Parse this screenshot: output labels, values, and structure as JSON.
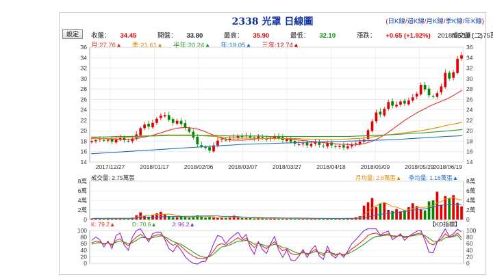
{
  "header": {
    "title": "2338 光罩 日線圖",
    "links": [
      "日K線",
      "週K線",
      "月K線",
      "季K線",
      "年K線"
    ],
    "active_link": 0
  },
  "settings_label": "設定",
  "quote": {
    "close_label": "收盤：",
    "close": "34.45",
    "open_label": "開盤：",
    "open": "33.80",
    "high_label": "最高：",
    "high": "35.90",
    "low_label": "最低：",
    "low": "32.10",
    "change_label": "漲跌：",
    "change": "+0.65 (+1.92%)",
    "volume": "成交量：2.75萬張",
    "date": "2018/06/19 (二)"
  },
  "ma": [
    {
      "label": "月:27.76▲",
      "color": "#e03020"
    },
    {
      "label": "季:21.61▲",
      "color": "#e08a00"
    },
    {
      "label": "半年:20.24▲",
      "color": "#2a9a2a"
    },
    {
      "label": "年:19.05▲",
      "color": "#2070c0"
    },
    {
      "label": "三年:12.74▲",
      "color": "#c00000"
    }
  ],
  "volume_panel": {
    "label": "成交量: 2.75萬張",
    "ma5": "月均量: 2.6萬張▲",
    "ma20": "季均量: 1.16萬張▲",
    "yticks": [
      "8萬",
      "6萬",
      "4萬",
      "2萬",
      "0"
    ]
  },
  "kd_panel": {
    "k": "K: 79.2▲",
    "d": "D: 70.6▲",
    "j": "J: 96.2▲",
    "title": "【KD指標】",
    "yticks": [
      "100",
      "80",
      "60",
      "40",
      "20",
      "0"
    ]
  },
  "colors": {
    "up": "#e00000",
    "down": "#008800",
    "k": "#e03020",
    "d": "#2a9a2a",
    "j": "#8a2ad0"
  },
  "chart_data": {
    "type": "line",
    "title": "2338 光罩 日線圖",
    "xlabel": "",
    "ylabel": "",
    "ylim": [
      14,
      36
    ],
    "yticks": [
      14,
      16,
      18,
      20,
      22,
      24,
      26,
      28,
      30,
      32,
      34,
      36
    ],
    "x_tick_labels": [
      "2017/12/27",
      "2018/01/17",
      "2018/02/06",
      "2018/03/07",
      "2018/03/27",
      "2018/04/18",
      "2018/05/09",
      "2018/05/29",
      "2018/06/19"
    ],
    "grid": true,
    "series": [
      {
        "kind": "close",
        "values": [
          18.0,
          18.2,
          18.4,
          18.1,
          18.3,
          17.9,
          18.4,
          18.6,
          18.2,
          18.0,
          18.5,
          19.3,
          20.5,
          21.2,
          20.8,
          21.5,
          22.3,
          22.9,
          23.0,
          22.1,
          21.5,
          21.9,
          21.3,
          20.6,
          19.8,
          18.7,
          17.4,
          16.9,
          16.7,
          16.2,
          17.2,
          18.1,
          18.4,
          18.2,
          18.5,
          18.7,
          19.0,
          18.8,
          19.1,
          18.7,
          18.4,
          18.9,
          18.5,
          18.3,
          18.6,
          19.0,
          18.6,
          18.2,
          18.4,
          17.9,
          17.5,
          17.4,
          17.6,
          17.2,
          17.5,
          17.8,
          17.3,
          17.0,
          17.6,
          17.2,
          16.9,
          17.1,
          16.8,
          17.0,
          17.4,
          17.6,
          17.9,
          18.3,
          20.1,
          21.8,
          23.5,
          23.1,
          24.2,
          25.5,
          24.8,
          25.0,
          25.6,
          25.2,
          25.8,
          26.4,
          27.1,
          28.8,
          27.9,
          26.8,
          26.5,
          27.2,
          28.5,
          31.1,
          30.0,
          31.2,
          33.8,
          34.45
        ]
      },
      {
        "kind": "ma",
        "name": "月",
        "values": [
          18.6,
          18.6,
          18.5,
          18.5,
          18.4,
          18.3,
          18.3,
          18.3,
          18.4,
          18.5,
          18.7,
          18.9,
          19.1,
          19.4,
          19.7,
          20.0,
          20.3,
          20.5,
          20.6,
          20.6,
          20.5,
          20.3,
          20.0,
          19.6,
          19.2,
          18.8,
          18.5,
          18.3,
          18.2,
          18.2,
          18.2,
          18.3,
          18.4,
          18.5,
          18.5,
          18.6,
          18.6,
          18.6,
          18.5,
          18.4,
          18.3,
          18.2,
          18.1,
          18.0,
          17.9,
          17.8,
          17.7,
          17.6,
          17.5,
          17.4,
          17.4,
          17.3,
          17.3,
          17.4,
          17.6,
          17.9,
          18.3,
          18.8,
          19.4,
          20.1,
          20.8,
          21.5,
          22.2,
          22.8,
          23.4,
          23.9,
          24.4,
          24.9,
          25.3,
          25.7,
          26.1,
          26.6,
          27.2,
          27.76
        ]
      },
      {
        "kind": "ma",
        "name": "季",
        "values": [
          18.5,
          18.5,
          18.5,
          18.6,
          18.7,
          18.8,
          18.9,
          19.0,
          19.1,
          19.2,
          19.2,
          19.2,
          19.2,
          19.1,
          19.0,
          18.9,
          18.8,
          18.7,
          18.6,
          18.6,
          18.5,
          18.5,
          18.5,
          18.5,
          18.5,
          18.5,
          18.4,
          18.4,
          18.4,
          18.3,
          18.3,
          18.4,
          18.5,
          18.6,
          18.8,
          19.0,
          19.2,
          19.4,
          19.6,
          19.8,
          20.0,
          20.3,
          20.6,
          21.0,
          21.3,
          21.61
        ]
      },
      {
        "kind": "ma",
        "name": "半年",
        "values": [
          18.8,
          18.8,
          18.9,
          18.9,
          19.0,
          19.0,
          19.1,
          19.1,
          19.1,
          19.1,
          19.1,
          19.0,
          19.0,
          19.0,
          18.9,
          18.9,
          18.9,
          18.9,
          18.9,
          18.9,
          18.9,
          19.0,
          19.1,
          19.2,
          19.3,
          19.5,
          19.6,
          19.8,
          20.0,
          20.24
        ]
      },
      {
        "kind": "ma",
        "name": "年",
        "values": [
          15.6,
          15.8,
          16.0,
          16.2,
          16.4,
          16.6,
          16.8,
          17.0,
          17.2,
          17.4,
          17.5,
          17.6,
          17.7,
          17.8,
          17.9,
          18.0,
          18.1,
          18.2,
          18.3,
          18.5,
          18.7,
          18.9,
          19.05
        ]
      }
    ],
    "volume_series": [
      0.2,
      0.3,
      0.2,
      0.2,
      0.3,
      0.3,
      0.2,
      0.2,
      0.3,
      0.2,
      0.4,
      0.9,
      1.5,
      0.8,
      0.6,
      1.0,
      1.3,
      1.6,
      1.1,
      0.7,
      0.5,
      0.5,
      0.6,
      0.5,
      0.4,
      0.6,
      0.9,
      0.6,
      0.4,
      0.5,
      0.4,
      0.3,
      0.4,
      0.3,
      0.5,
      0.8,
      0.4,
      0.3,
      0.3,
      0.3,
      0.2,
      0.3,
      0.3,
      0.2,
      0.3,
      0.3,
      0.2,
      0.2,
      0.2,
      0.3,
      0.2,
      0.2,
      0.2,
      0.2,
      0.2,
      0.2,
      0.3,
      0.2,
      0.2,
      0.2,
      0.2,
      0.2,
      0.3,
      0.3,
      0.3,
      0.5,
      0.7,
      2.9,
      3.6,
      4.5,
      2.6,
      3.3,
      3.6,
      2.0,
      1.8,
      2.2,
      1.7,
      1.9,
      2.6,
      3.4,
      2.8,
      2.1,
      1.9,
      3.8,
      4.0,
      5.8,
      3.1,
      4.9,
      4.4,
      5.1,
      3.5,
      2.75
    ],
    "kd_k": [
      62,
      68,
      66,
      58,
      64,
      55,
      70,
      75,
      62,
      54,
      68,
      80,
      88,
      80,
      72,
      82,
      86,
      88,
      78,
      64,
      55,
      60,
      52,
      40,
      30,
      22,
      16,
      15,
      14,
      22,
      38,
      55,
      60,
      55,
      62,
      70,
      78,
      70,
      76,
      60,
      48,
      62,
      52,
      45,
      56,
      66,
      50,
      38,
      44,
      30,
      26,
      28,
      36,
      26,
      34,
      42,
      30,
      24,
      40,
      30,
      24,
      30,
      24,
      32,
      44,
      52,
      62,
      72,
      85,
      90,
      92,
      84,
      88,
      90,
      80,
      82,
      86,
      78,
      82,
      86,
      90,
      92,
      80,
      62,
      56,
      66,
      74,
      90,
      80,
      84,
      92,
      79.2
    ],
    "kd_d": [
      58,
      62,
      63,
      60,
      62,
      58,
      64,
      68,
      65,
      60,
      63,
      70,
      78,
      78,
      75,
      78,
      81,
      84,
      81,
      74,
      66,
      62,
      58,
      50,
      42,
      34,
      26,
      20,
      18,
      20,
      28,
      40,
      50,
      52,
      56,
      62,
      68,
      68,
      70,
      66,
      58,
      60,
      57,
      52,
      54,
      58,
      55,
      48,
      46,
      40,
      34,
      30,
      32,
      30,
      31,
      36,
      34,
      30,
      34,
      32,
      28,
      29,
      27,
      29,
      35,
      42,
      50,
      58,
      68,
      76,
      82,
      83,
      85,
      86,
      84,
      83,
      84,
      82,
      82,
      84,
      86,
      88,
      85,
      76,
      68,
      67,
      69,
      78,
      79,
      81,
      86,
      70.6
    ],
    "kd_j": [
      70,
      80,
      72,
      50,
      68,
      45,
      85,
      92,
      55,
      40,
      80,
      100,
      105,
      85,
      65,
      90,
      95,
      95,
      72,
      45,
      35,
      55,
      40,
      20,
      8,
      0,
      -2,
      5,
      6,
      28,
      60,
      85,
      80,
      60,
      75,
      85,
      95,
      75,
      88,
      48,
      28,
      66,
      42,
      30,
      60,
      82,
      40,
      18,
      40,
      10,
      8,
      22,
      42,
      18,
      40,
      54,
      22,
      12,
      52,
      26,
      16,
      32,
      18,
      38,
      60,
      72,
      86,
      100,
      115,
      118,
      112,
      86,
      94,
      98,
      72,
      80,
      90,
      70,
      82,
      90,
      98,
      100,
      70,
      34,
      32,
      64,
      84,
      114,
      82,
      90,
      104,
      96.2
    ]
  }
}
